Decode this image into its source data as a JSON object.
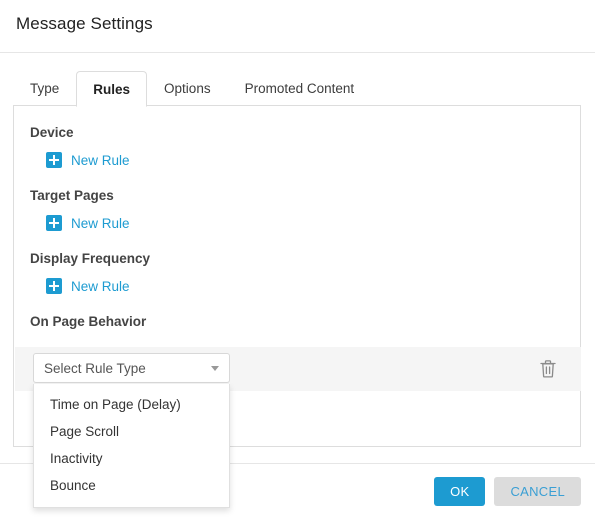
{
  "dialog": {
    "title": "Message Settings"
  },
  "tabs": [
    {
      "label": "Type",
      "active": false
    },
    {
      "label": "Rules",
      "active": true
    },
    {
      "label": "Options",
      "active": false
    },
    {
      "label": "Promoted Content",
      "active": false
    }
  ],
  "sections": [
    {
      "title": "Device",
      "action_label": "New Rule"
    },
    {
      "title": "Target Pages",
      "action_label": "New Rule"
    },
    {
      "title": "Display Frequency",
      "action_label": "New Rule"
    },
    {
      "title": "On Page Behavior"
    }
  ],
  "rule_row": {
    "select": {
      "value": "Select Rule Type",
      "caret": "chevron-down-icon"
    },
    "delete_icon": "trash-icon"
  },
  "dropdown": {
    "open": true,
    "options": [
      "Time on Page (Delay)",
      "Page Scroll",
      "Inactivity",
      "Bounce"
    ]
  },
  "footer": {
    "ok_label": "OK",
    "cancel_label": "CANCEL"
  },
  "colors": {
    "accent_blue": "#1d9bd1",
    "cancel_bg": "#dcdcdc",
    "row_bg": "#f5f5f5",
    "border": "#dddddd"
  }
}
